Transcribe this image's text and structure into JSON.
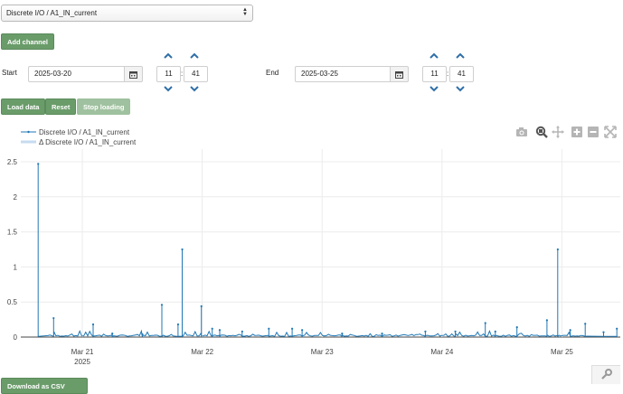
{
  "channel_select": {
    "value": "Discrete I/O / A1_IN_current"
  },
  "buttons": {
    "add_channel": "Add channel",
    "load_data": "Load data",
    "reset": "Reset",
    "stop_loading": "Stop loading",
    "bottom_partial": "Download as CSV"
  },
  "start": {
    "label": "Start",
    "date": "2025-03-20",
    "hour": "11",
    "minute": "41"
  },
  "end": {
    "label": "End",
    "date": "2025-03-25",
    "hour": "11",
    "minute": "41"
  },
  "time_separator": ":",
  "icons": {
    "calendar": "calendar-icon",
    "spin_up": "chevron-up-icon",
    "spin_down": "chevron-down-icon",
    "camera": "camera-icon",
    "zoom": "zoom-icon",
    "pan": "pan-icon",
    "zoom_in": "zoom-in-icon",
    "zoom_out": "zoom-out-icon",
    "autoscale": "autoscale-icon",
    "wrench": "wrench-icon"
  },
  "colors": {
    "accent_green": "#6a9c6a",
    "series_line": "#1f77b4",
    "delta_series": "#c6dbef"
  },
  "chart_data": {
    "type": "line",
    "legend": [
      "Discrete I/O / A1_IN_current",
      "Δ Discrete I/O / A1_IN_current"
    ],
    "legend_placement": "top-left",
    "grid": true,
    "ylim": [
      0,
      2.5
    ],
    "yticks": [
      "2.5",
      "2",
      "1.5",
      "1",
      "0.5",
      "0"
    ],
    "xlim": [
      "2025-03-20T11:41",
      "2025-03-25T11:41"
    ],
    "xticks": [
      {
        "label": "Mar 21",
        "sub": "2025",
        "t": "2025-03-21T00:00"
      },
      {
        "label": "Mar 22",
        "sub": "",
        "t": "2025-03-22T00:00"
      },
      {
        "label": "Mar 23",
        "sub": "",
        "t": "2025-03-23T00:00"
      },
      {
        "label": "Mar 24",
        "sub": "",
        "t": "2025-03-24T00:00"
      },
      {
        "label": "Mar 25",
        "sub": "",
        "t": "2025-03-25T00:00"
      }
    ],
    "series": [
      {
        "name": "Discrete I/O / A1_IN_current",
        "baseline": 0.01,
        "spikes": [
          {
            "t": "2025-03-20T15:10",
            "y": 2.47
          },
          {
            "t": "2025-03-20T18:15",
            "y": 0.27
          },
          {
            "t": "2025-03-21T02:10",
            "y": 0.18
          },
          {
            "t": "2025-03-21T06:00",
            "y": 0.05
          },
          {
            "t": "2025-03-21T12:00",
            "y": 0.04
          },
          {
            "t": "2025-03-21T15:55",
            "y": 0.46
          },
          {
            "t": "2025-03-21T19:10",
            "y": 0.18
          },
          {
            "t": "2025-03-21T20:00",
            "y": 1.25
          },
          {
            "t": "2025-03-21T23:50",
            "y": 0.44
          },
          {
            "t": "2025-03-22T02:00",
            "y": 0.12
          },
          {
            "t": "2025-03-22T03:30",
            "y": 0.1
          },
          {
            "t": "2025-03-22T08:00",
            "y": 0.08
          },
          {
            "t": "2025-03-22T13:20",
            "y": 0.12
          },
          {
            "t": "2025-03-22T18:00",
            "y": 0.12
          },
          {
            "t": "2025-03-22T20:00",
            "y": 0.1
          },
          {
            "t": "2025-03-23T04:00",
            "y": 0.05
          },
          {
            "t": "2025-03-23T12:00",
            "y": 0.05
          },
          {
            "t": "2025-03-23T20:40",
            "y": 0.08
          },
          {
            "t": "2025-03-24T02:40",
            "y": 0.08
          },
          {
            "t": "2025-03-24T08:40",
            "y": 0.2
          },
          {
            "t": "2025-03-24T10:40",
            "y": 0.08
          },
          {
            "t": "2025-03-24T15:00",
            "y": 0.14
          },
          {
            "t": "2025-03-24T21:00",
            "y": 0.24
          },
          {
            "t": "2025-03-24T23:10",
            "y": 1.25
          },
          {
            "t": "2025-03-25T01:40",
            "y": 0.1
          },
          {
            "t": "2025-03-25T04:40",
            "y": 0.19
          },
          {
            "t": "2025-03-25T08:20",
            "y": 0.07
          },
          {
            "t": "2025-03-25T11:00",
            "y": 0.12
          }
        ]
      }
    ]
  }
}
